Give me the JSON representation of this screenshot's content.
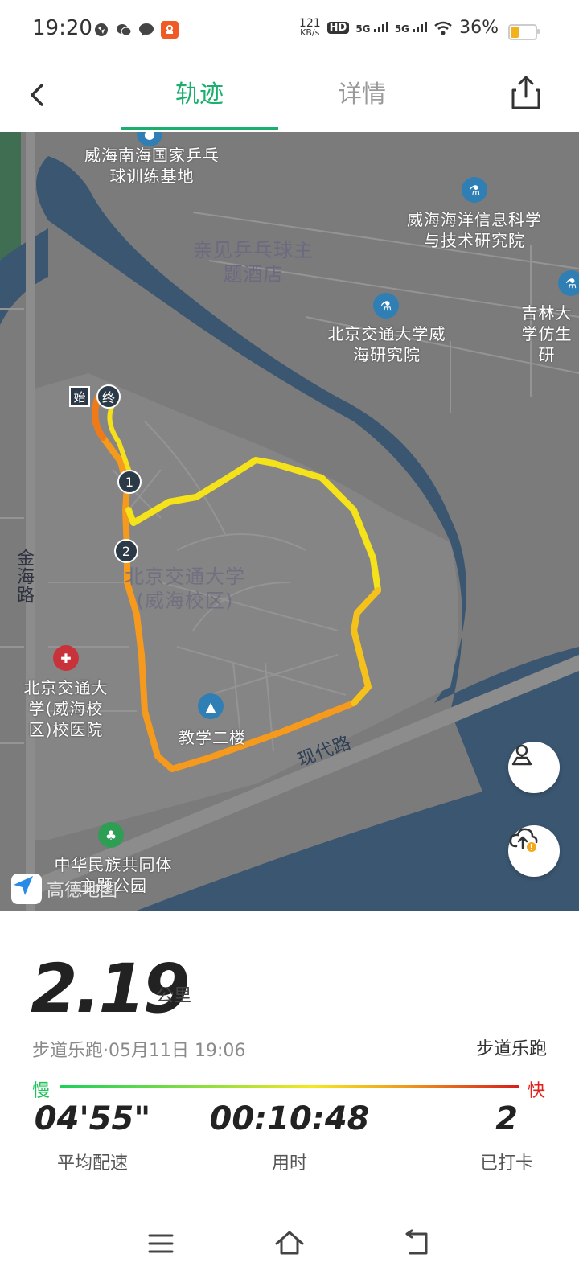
{
  "status_bar": {
    "time": "19:20",
    "net_speed_value": "121",
    "net_speed_unit": "KB/s",
    "hd_label": "HD",
    "signal1": "5G",
    "signal2": "5G",
    "battery_pct": "36%",
    "battery_level": 0.36,
    "battery_color": "#f2b21c",
    "left_icons": [
      "vpn-icon",
      "wechat-icon",
      "message-icon",
      "app-icon"
    ]
  },
  "header": {
    "tabs": [
      {
        "label": "轨迹",
        "active": true
      },
      {
        "label": "详情",
        "active": false
      }
    ],
    "accent_color": "#1aaf6c",
    "back_icon": "chevron-left-icon",
    "share_icon": "share-icon"
  },
  "map": {
    "labels": [
      {
        "text": "威海南海国家乒乓球训练基地"
      },
      {
        "text": "亲见乒乓球主题酒店"
      },
      {
        "text": "威海海洋信息科学与技术研究院"
      },
      {
        "text": "北京交通大学威海研究院"
      },
      {
        "text": "吉林大学仿生研"
      },
      {
        "text": "北京交通大学(威海校区)"
      },
      {
        "text": "金海路"
      },
      {
        "text": "北京交通大学(威海校区)校医院"
      },
      {
        "text": "教学二楼"
      },
      {
        "text": "现代路"
      },
      {
        "text": "中华民族共同体主题公园"
      }
    ],
    "start_label": "始",
    "end_label": "终",
    "checkpoints": [
      "1",
      "2"
    ],
    "provider": "高德地图",
    "route_icon": "route-pin-icon",
    "upload_icon": "cloud-upload-icon"
  },
  "summary": {
    "distance": "2.19",
    "distance_unit": "公里",
    "meta": "步道乐跑·05月11日 19:06",
    "activity_type": "步道乐跑",
    "slow_label": "慢",
    "fast_label": "快",
    "stats": [
      {
        "value": "04'55\"",
        "label": "平均配速"
      },
      {
        "value": "00:10:48",
        "label": "用时"
      },
      {
        "value": "2",
        "label": "已打卡"
      }
    ]
  },
  "system_nav": {
    "icons": [
      "menu-icon",
      "home-icon",
      "back-nav-icon"
    ]
  }
}
